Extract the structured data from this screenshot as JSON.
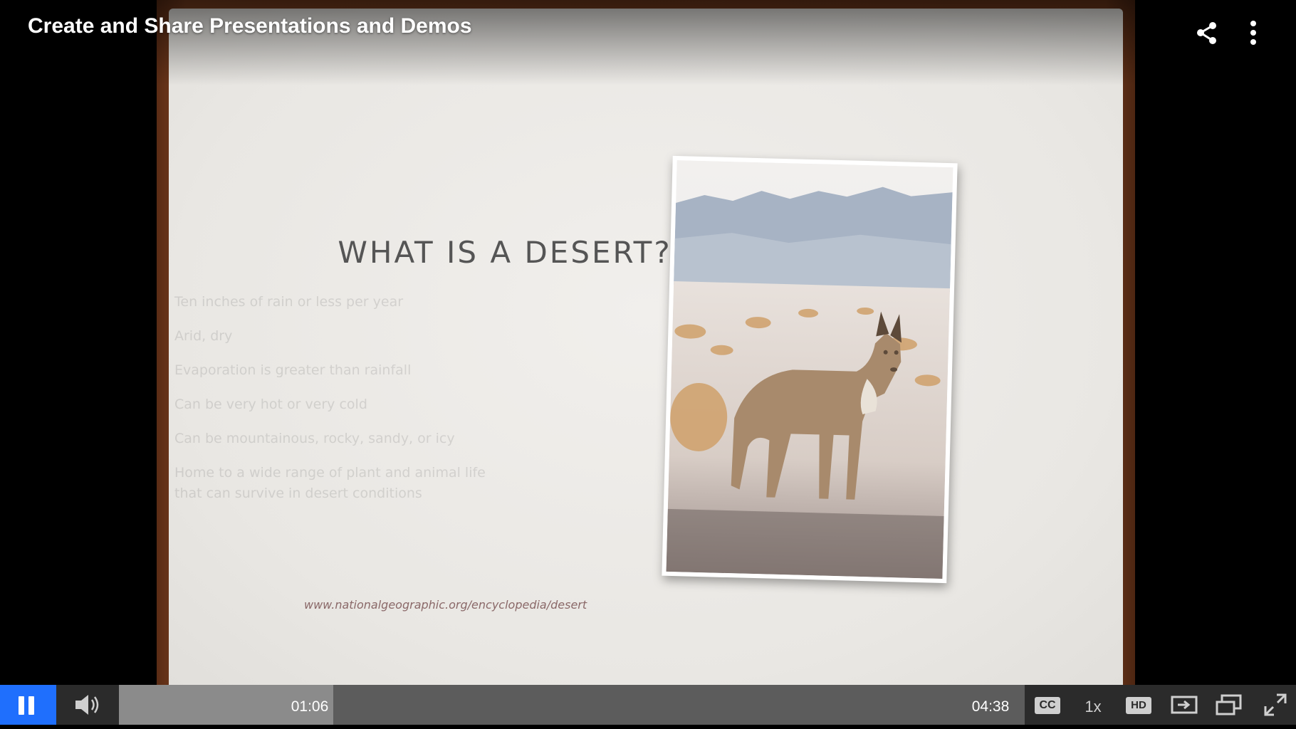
{
  "video": {
    "title": "Create and Share Presentations and Demos"
  },
  "slide": {
    "heading": "WHAT IS A DESERT?",
    "bullets": [
      "Ten inches of rain or less per year",
      "Arid, dry",
      "Evaporation is greater than rainfall",
      "Can be very hot or very cold",
      "Can be mountainous, rocky, sandy, or icy",
      "Home to a wide range of plant and animal life that can survive in desert conditions"
    ],
    "source": "www.nationalgeographic.org/encyclopedia/desert",
    "photo_subject": "coyote-in-desert"
  },
  "controls": {
    "current_time": "01:06",
    "total_time": "04:38",
    "progress_fraction": 0.237,
    "cc_label": "CC",
    "speed_label": "1x",
    "hd_label": "HD",
    "accent_color": "#1f6ffd"
  },
  "icons": {
    "share": "share-icon",
    "more": "more-vertical-icon",
    "pause": "pause-icon",
    "volume": "volume-icon",
    "watch_later": "watch-later-icon",
    "pip": "picture-in-picture-icon",
    "fullscreen": "fullscreen-icon"
  }
}
